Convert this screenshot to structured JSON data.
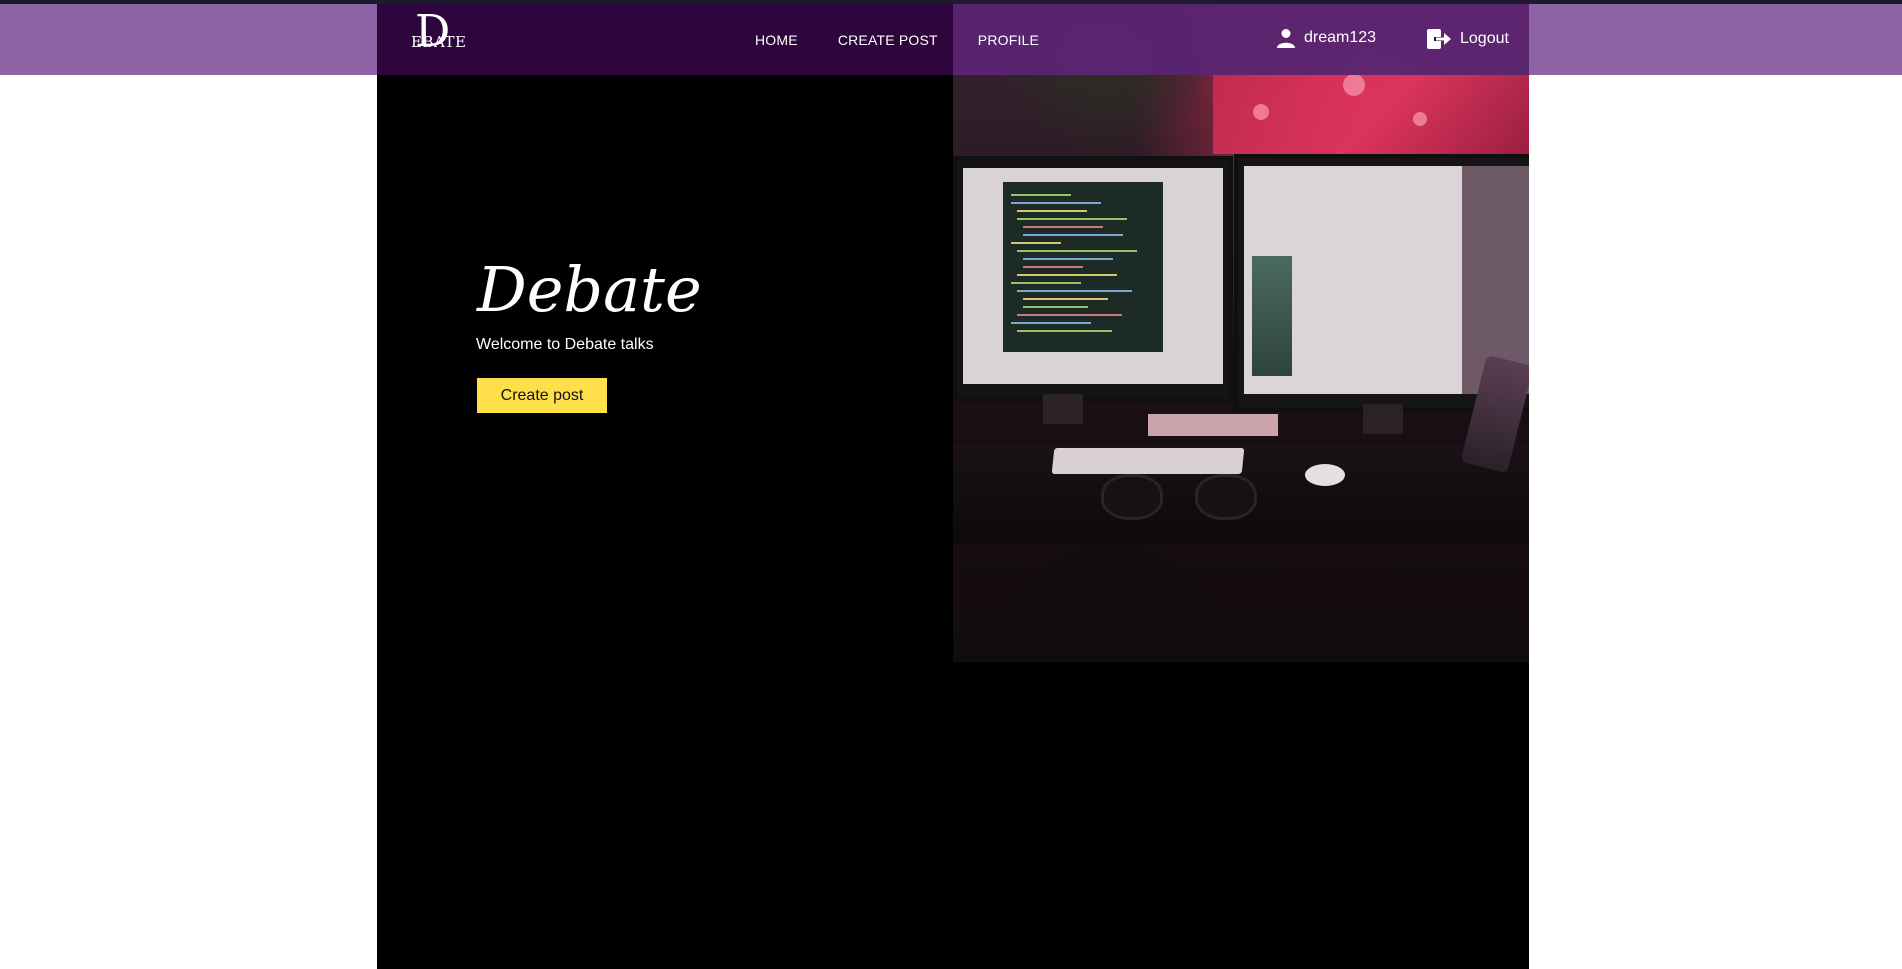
{
  "navbar": {
    "logo_letter": "D",
    "logo_word": "EBATE",
    "links": [
      {
        "label": "HOME"
      },
      {
        "label": "CREATE POST"
      },
      {
        "label": "PROFILE"
      }
    ],
    "username": "dream123",
    "user_icon": "user-icon",
    "logout_label": "Logout",
    "logout_icon": "logout-icon"
  },
  "hero": {
    "title": "Debate",
    "subtitle": "Welcome to Debate talks",
    "button_label": "Create post",
    "image_description_icon": "workspace-photo"
  },
  "colors": {
    "nav_outer": "#8e63a6",
    "nav_inner": "#32063f",
    "accent_button": "#ffe04a",
    "background": "#000000"
  }
}
